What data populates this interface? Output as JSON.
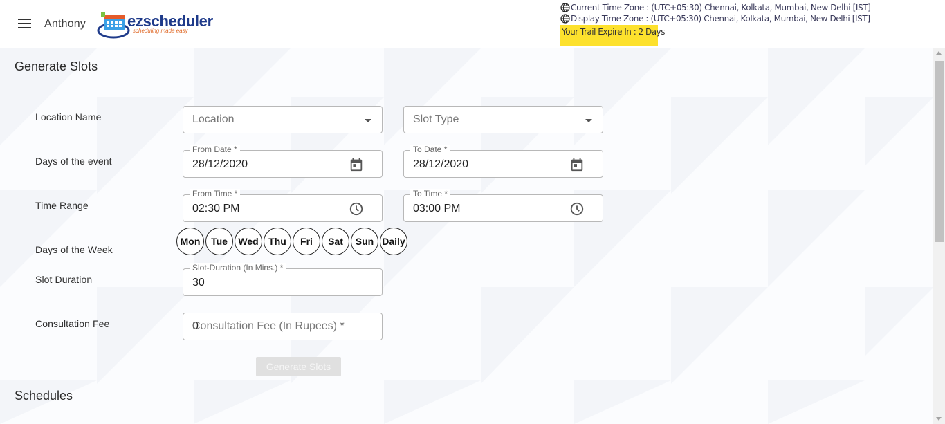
{
  "header": {
    "user_name": "Anthony",
    "logo_text": "ezscheduler",
    "logo_tagline": "scheduling made easy",
    "current_tz": "Current Time Zone : (UTC+05:30) Chennai, Kolkata, Mumbai, New Delhi [IST]",
    "display_tz": "Display Time Zone : (UTC+05:30) Chennai, Kolkata, Mumbai, New Delhi [IST]",
    "trial": "Your Trail Expire In : 2 Days"
  },
  "form": {
    "title": "Generate Slots",
    "labels": {
      "location_name": "Location Name",
      "days_event": "Days of the event",
      "time_range": "Time Range",
      "days_week": "Days of the Week",
      "slot_duration": "Slot Duration",
      "consultation_fee": "Consultation Fee"
    },
    "location": {
      "placeholder": "Location"
    },
    "slot_type": {
      "placeholder": "Slot Type"
    },
    "from_date": {
      "label": "From Date *",
      "value": "28/12/2020"
    },
    "to_date": {
      "label": "To Date *",
      "value": "28/12/2020"
    },
    "from_time": {
      "label": "From Time *",
      "value": "02:30 PM"
    },
    "to_time": {
      "label": "To Time *",
      "value": "03:00 PM"
    },
    "days": [
      "Mon",
      "Tue",
      "Wed",
      "Thu",
      "Fri",
      "Sat",
      "Sun",
      "Daily"
    ],
    "slot_duration": {
      "label": "Slot-Duration (In Mins.) *",
      "value": "30"
    },
    "fee": {
      "value": "0",
      "placeholder": "Consultation Fee (In Rupees) *"
    },
    "generate_button": "Generate Slots"
  },
  "schedules": {
    "title": "Schedules"
  },
  "colors": {
    "trial_bg": "#fde12d",
    "brand": "#1e3a8a",
    "tagline": "#e06b2a"
  },
  "icons": [
    "menu-icon",
    "globe-icon",
    "calendar-icon",
    "clock-icon",
    "dropdown-caret-icon"
  ]
}
